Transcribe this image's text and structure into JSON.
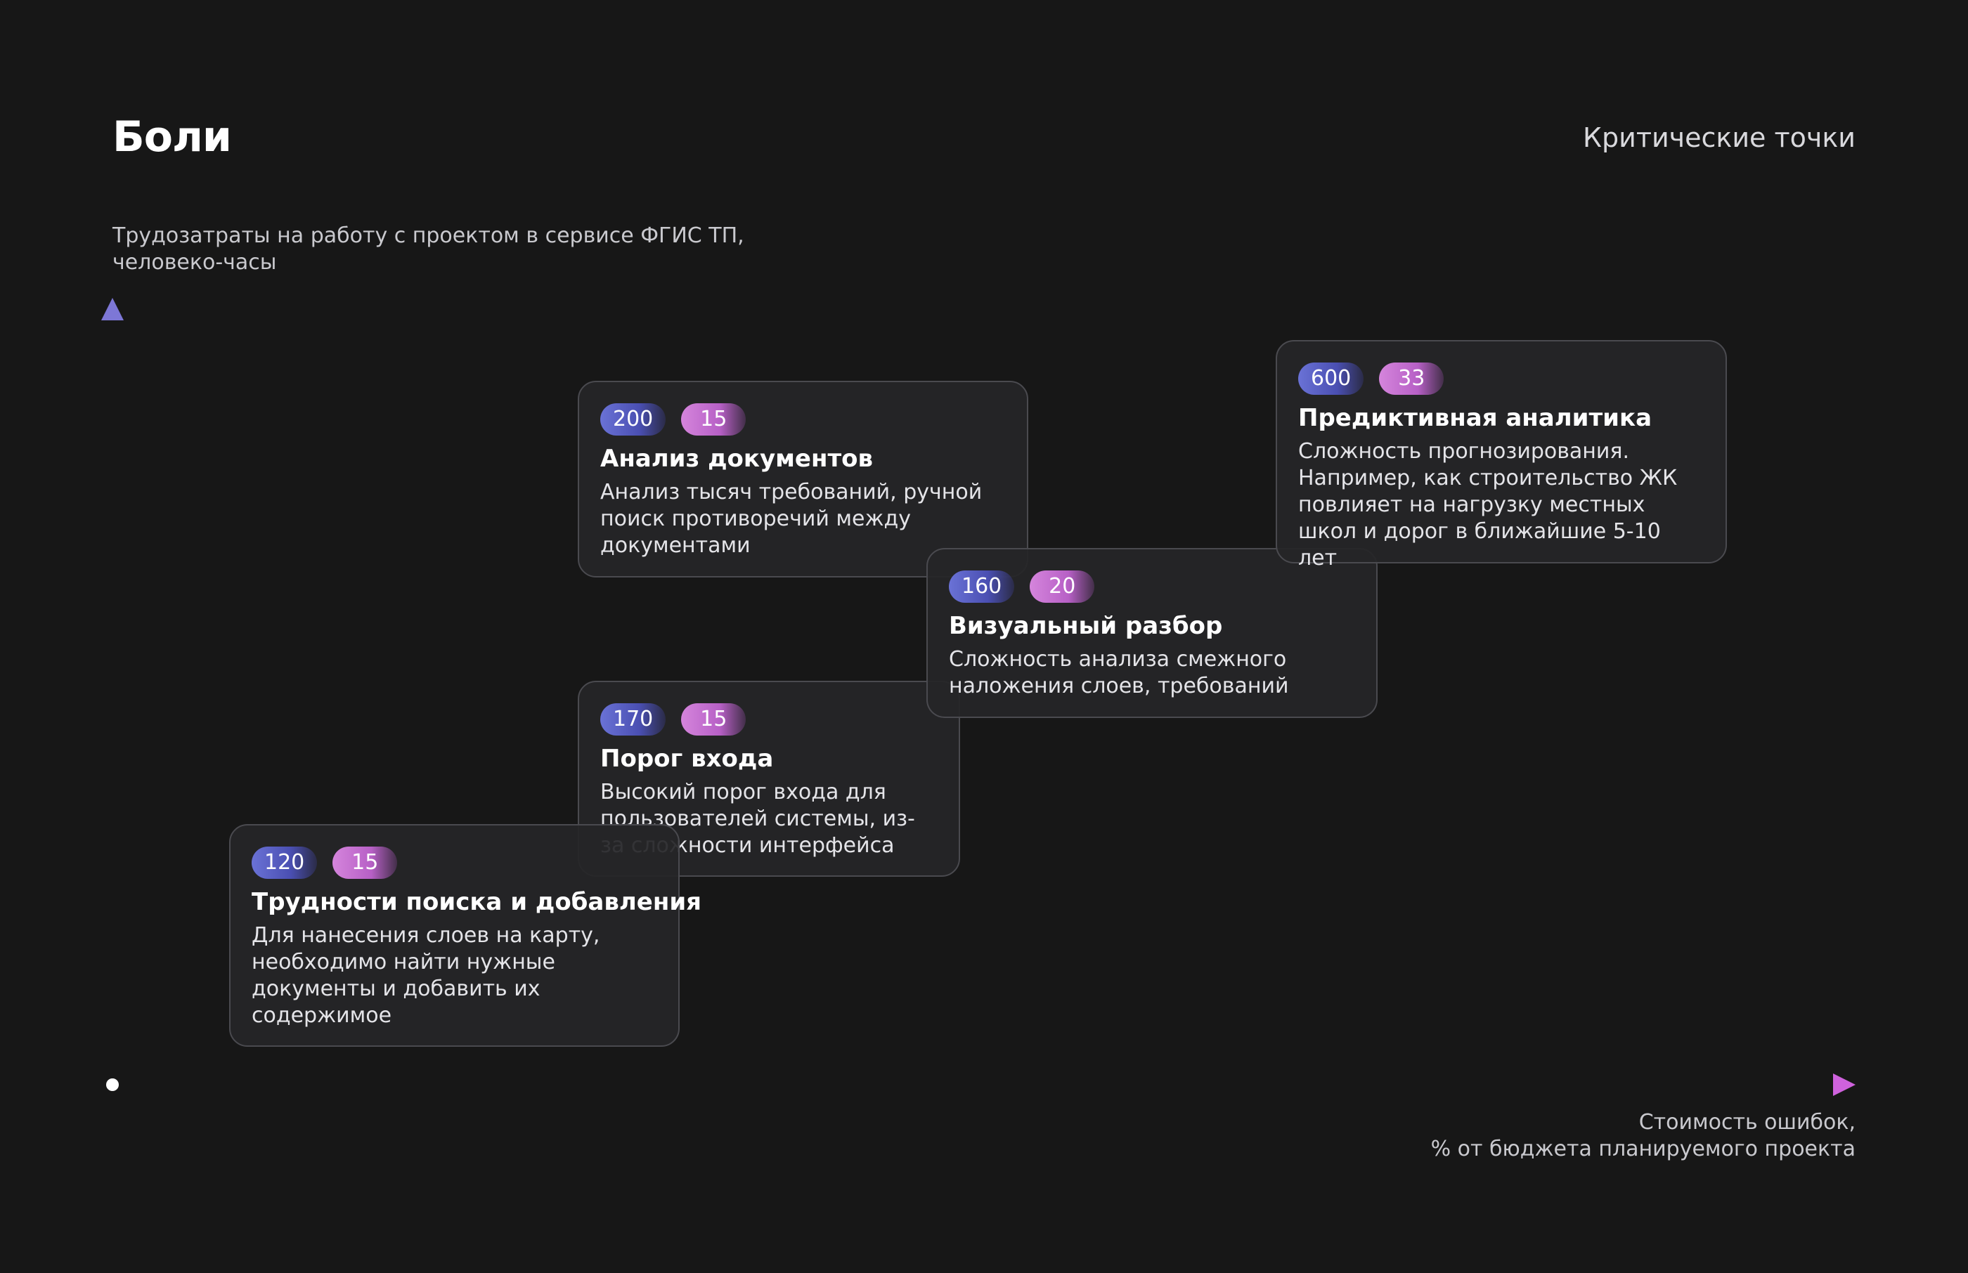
{
  "header": {
    "title": "Боли",
    "section_label": "Критические точки"
  },
  "axes": {
    "y_label": "Трудозатраты на работу с проектом в сервисе ФГИС ТП,\nчеловеко-часы",
    "x_label": "Стоимость ошибок,\n% от бюджета планируемого проекта",
    "y_axis_color": "#7d77d6",
    "x_axis_color": "#c25cd2"
  },
  "cards": [
    {
      "id": "predictive",
      "hours": "600",
      "cost": "33",
      "title": "Предиктивная аналитика",
      "text": "Сложность прогнозирования. Например, как строительство ЖК повлияет на нагрузку местных школ и дорог в ближайшие 5-10 лет"
    },
    {
      "id": "visual",
      "hours": "160",
      "cost": "20",
      "title": "Визуальный разбор",
      "text": "Сложность анализа смежного наложения слоев, требований"
    },
    {
      "id": "docs",
      "hours": "200",
      "cost": "15",
      "title": "Анализ документов",
      "text": "Анализ тысяч требований, ручной поиск противоречий между документами"
    },
    {
      "id": "entry",
      "hours": "170",
      "cost": "15",
      "title": "Порог входа",
      "text": "Высокий порог входа для пользователей системы, из-за сложности интерфейса"
    },
    {
      "id": "search",
      "hours": "120",
      "cost": "15",
      "title": "Трудности поиска и добавления",
      "text": "Для нанесения слоев на карту, необходимо найти нужные документы и добавить их содержимое"
    }
  ],
  "badge_colors": {
    "hours": "#5a5fc4",
    "cost": "#c774d2"
  }
}
